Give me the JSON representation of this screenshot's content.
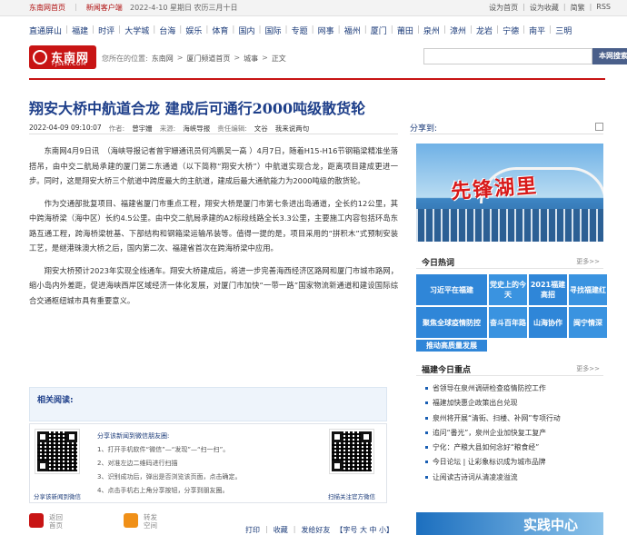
{
  "topbar": {
    "home": "东南网首页",
    "client": "新闻客户端",
    "date": "2022-4-10 星期日 农历三月十日",
    "right": [
      "设为首页",
      "设为收藏",
      "简繁",
      "RSS"
    ]
  },
  "nav": [
    "直通屏山",
    "福建",
    "时评",
    "大学城",
    "台海",
    "娱乐",
    "体育",
    "国内",
    "国际",
    "专题",
    "网事",
    "福州",
    "厦门",
    "莆田",
    "泉州",
    "漳州",
    "龙岩",
    "宁德",
    "南平",
    "三明"
  ],
  "logo": {
    "name": "东南网",
    "domain": "FJSEN.COM"
  },
  "breadcrumb": [
    "您所在的位置:",
    "东南网",
    "厦门频道首页",
    "城事",
    "正文"
  ],
  "search": {
    "placeholder": "",
    "button": "本网搜索"
  },
  "article": {
    "title": "翔安大桥中航道合龙 建成后可通行2000吨级散货轮",
    "datetime": "2022-04-09 09:10:07",
    "author_label": "作者:",
    "author": "曾宇姗",
    "source_label": "来源:",
    "source": "海峡导报",
    "editor_label": "责任编辑:",
    "editor": "文谷",
    "print": "我来说两句",
    "share_label": "分享到:",
    "paragraphs": [
      "东南网4月9日讯　（海峡导报记者曾宇姗通讯员何鸿鹏吴一高 ）4月7日，随着H15-H16节钢箱梁精准坐落搭吊，由中交二航局承建的厦门第二东通道（以下简称“翔安大桥”）中航道实现合龙，距离项目建成更进一步。同时，这是翔安大桥三个航道中跨度最大的主航道，建成后最大通航能力为2000吨级的散货轮。",
      "作为交通部批复项目、福建省厦门市重点工程，翔安大桥是厦门市第七条进出岛通道，全长约12公里，其中跨海桥梁（海中区）长约4.5公里。由中交二航局承建的A2标段线路全长3.3公里，主要施工内容包括环岛东路互通工程，跨海桥梁桩基、下部结构和钢箱梁运输吊装等。值得一提的是，项目采用的“拼积木”式预制安装工艺，是继港珠澳大桥之后，国内第二次、福建省首次在跨海桥梁中应用。",
      "翔安大桥预计2023年实现全线通车。翔安大桥建成后，将进一步完善海西经济区路网和厦门市城市路网，缩小岛内外差距，促进海峡西岸区域经济一体化发展，对厦门市加快“一带一路”国家物流新通道和建设国际综合交通枢纽城市具有重要意义。"
    ]
  },
  "related": {
    "title": "相关阅读:"
  },
  "qr": {
    "caption_left": "分享该新闻到微信",
    "caption_right": "扫描关注官方微信",
    "steps_title": "分享该新闻到微信朋友圈:",
    "steps": [
      "1、打开手机软件“微信”—“发现”—“扫一扫”。",
      "2、对准左边二维码进行扫描",
      "3、识别成功后，弹出是否浏览该页面，点击确定。",
      "4、点击手机右上角分享按钮，分享到朋友圈。"
    ]
  },
  "bottom": {
    "back_home": [
      "返回",
      "首页"
    ],
    "repost": [
      "转发",
      "空间"
    ],
    "tools": [
      "打印",
      "收藏",
      "发给好友"
    ],
    "font": "【字号 大 中 小】"
  },
  "sidebar": {
    "banner_text": "先锋湖里",
    "hot_title": "今日热词",
    "more": "更多>>",
    "hot": [
      [
        "习近平在福建"
      ],
      [
        "党史上的今天"
      ],
      [
        "2021福建高招"
      ],
      [
        "寻找福建红"
      ],
      [
        "聚焦全球疫情防控"
      ],
      [
        "奋斗百年路"
      ],
      [
        "山海协作"
      ],
      [
        "闽宁情深"
      ],
      [
        "推动高质量发展"
      ]
    ],
    "news_title": "福建今日重点",
    "news": [
      "省领导在泉州调研检查疫情防控工作",
      "福建加快惠企政策出台兑现",
      "泉州将开展“清街、扫楼、补网”专项行动",
      "追问“番光”，泉州企业加快复工复产",
      "宁化：产粮大县如何念好“粮食经”",
      "今日论坛 | 让彩象标识成为城市品牌",
      "让阅读古诗词从清凌凌溢流"
    ],
    "banner2_text": "实践中心"
  }
}
